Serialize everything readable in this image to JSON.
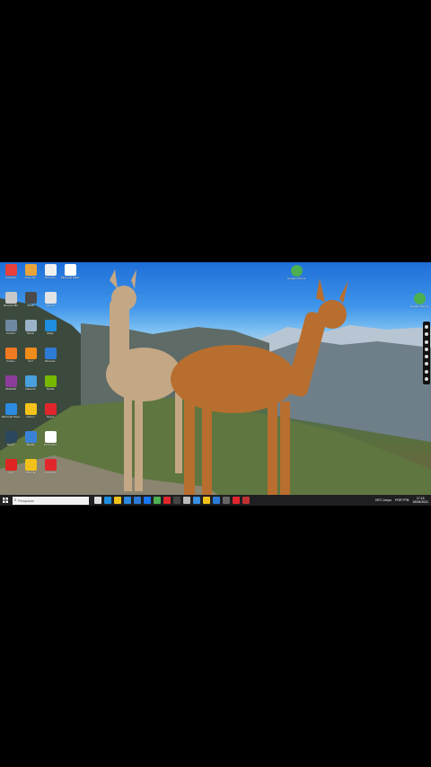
{
  "desktop": {
    "icons_left": [
      {
        "label": "AnyDesk",
        "name": "anydesk-icon",
        "color": "#e8403a"
      },
      {
        "label": "Free Fire",
        "name": "game-icon",
        "color": "#e9a43a"
      },
      {
        "label": "Nitro Pro",
        "name": "app-icon",
        "color": "#f0f0f0"
      },
      {
        "label": "Microsoft Mathematics",
        "name": "document-icon",
        "color": "#ffffff"
      },
      {
        "label": "Recycle Bin",
        "name": "recycle-bin-icon",
        "color": "#c8c8c8"
      },
      {
        "label": "Clock",
        "name": "clock-icon",
        "color": "#4a4a4a"
      },
      {
        "label": "Report",
        "name": "file-icon",
        "color": "#e3e3e3"
      },
      {
        "label": "Control",
        "name": "settings-icon",
        "color": "#6f8aa0"
      },
      {
        "label": "Music",
        "name": "music-icon",
        "color": "#9bb3c8"
      },
      {
        "label": "Edge",
        "name": "edge-icon",
        "color": "#1f8ee0"
      },
      {
        "label": "Firefox",
        "name": "firefox-icon",
        "color": "#f07a22"
      },
      {
        "label": "VLC",
        "name": "vlc-icon",
        "color": "#f08c1a"
      },
      {
        "label": "Browser",
        "name": "browser-icon",
        "color": "#2e7bd6"
      },
      {
        "label": "WinRAR",
        "name": "winrar-icon",
        "color": "#8c3c9a"
      },
      {
        "label": "Network",
        "name": "network-icon",
        "color": "#49a0dc"
      },
      {
        "label": "Nvidia",
        "name": "nvidia-icon",
        "color": "#76b900"
      },
      {
        "label": "Microsoft Store",
        "name": "store-icon",
        "color": "#2b8be0"
      },
      {
        "label": "Norton",
        "name": "norton-icon",
        "color": "#f5c21a"
      },
      {
        "label": "Opera",
        "name": "opera-icon",
        "color": "#e0262c"
      },
      {
        "label": "Steam",
        "name": "steam-icon",
        "color": "#2a475e"
      },
      {
        "label": "Media",
        "name": "media-icon",
        "color": "#3a82d8"
      },
      {
        "label": "Document",
        "name": "document-icon",
        "color": "#ffffff"
      },
      {
        "label": "App",
        "name": "app-icon",
        "color": "#e02424"
      },
      {
        "label": "Chrome",
        "name": "chrome-icon",
        "color": "#f2c21b"
      },
      {
        "label": "Antivirus",
        "name": "antivirus-icon",
        "color": "#e3262c"
      }
    ],
    "icon_center": {
      "label": "Google Chrome",
      "name": "chrome-icon",
      "color": "#4caf50"
    },
    "icon_right": {
      "label": "Google Chrome",
      "name": "chrome-icon",
      "color": "#4caf50"
    }
  },
  "taskbar": {
    "search_placeholder": "Pesquisar",
    "apps": [
      {
        "name": "task-view-icon",
        "color": "#e0e0e0"
      },
      {
        "name": "edge-icon",
        "color": "#1f8ee0"
      },
      {
        "name": "file-explorer-icon",
        "color": "#f2c21b"
      },
      {
        "name": "store-icon",
        "color": "#2b8be0"
      },
      {
        "name": "mail-icon",
        "color": "#2b7bd6"
      },
      {
        "name": "facebook-icon",
        "color": "#1877f2"
      },
      {
        "name": "chrome-icon",
        "color": "#4caf50"
      },
      {
        "name": "media-icon",
        "color": "#e0262c"
      },
      {
        "name": "app-icon",
        "color": "#444444"
      },
      {
        "name": "photos-icon",
        "color": "#bbbbbb"
      },
      {
        "name": "calculator-icon",
        "color": "#3a8ee0"
      },
      {
        "name": "chrome-icon",
        "color": "#f2c21b"
      },
      {
        "name": "settings-icon",
        "color": "#2b7bd6"
      },
      {
        "name": "app-icon",
        "color": "#666666"
      },
      {
        "name": "recorder-icon",
        "color": "#e0262c"
      },
      {
        "name": "app-icon",
        "color": "#c03030"
      }
    ],
    "weather": "26°C Limpo",
    "language": "POR PTB",
    "time": "17:15",
    "date": "18/06/2021"
  }
}
